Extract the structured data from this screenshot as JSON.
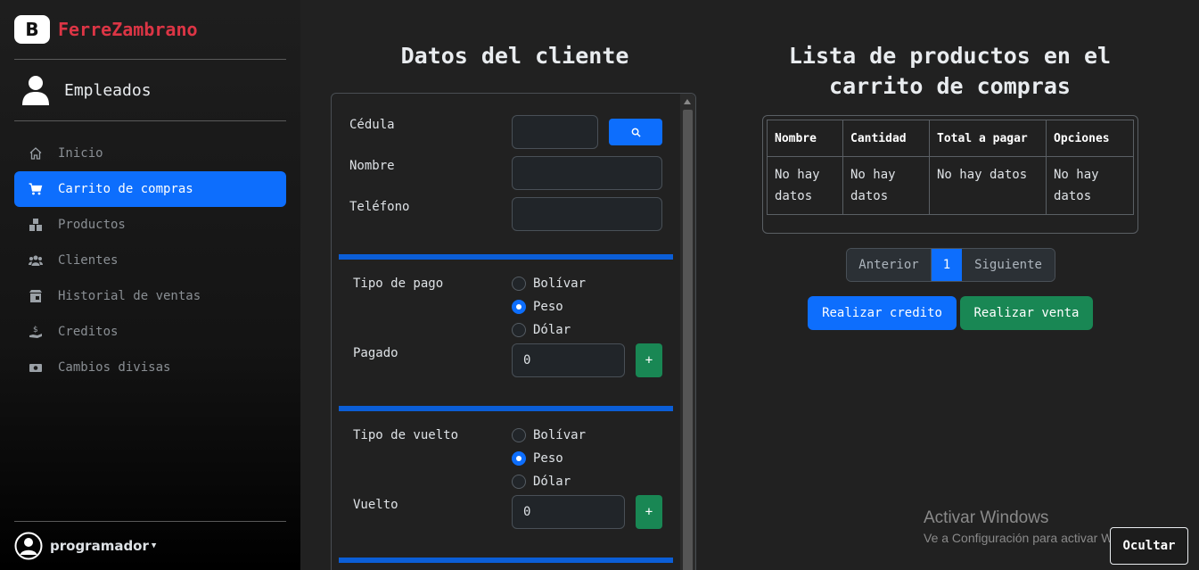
{
  "brand": {
    "logo_letter": "B",
    "name": "FerreZambrano",
    "color": "#dc3545"
  },
  "user_section": {
    "label": "Empleados"
  },
  "nav": {
    "items": [
      {
        "label": "Inicio",
        "icon": "home-icon",
        "active": false
      },
      {
        "label": "Carrito de compras",
        "icon": "cart-icon",
        "active": true
      },
      {
        "label": "Productos",
        "icon": "boxes-icon",
        "active": false
      },
      {
        "label": "Clientes",
        "icon": "people-icon",
        "active": false
      },
      {
        "label": "Historial de ventas",
        "icon": "shop-history-icon",
        "active": false
      },
      {
        "label": "Creditos",
        "icon": "hand-dollar-icon",
        "active": false
      },
      {
        "label": "Cambios divisas",
        "icon": "cash-exchange-icon",
        "active": false
      }
    ]
  },
  "footer": {
    "username": "programador"
  },
  "client": {
    "title": "Datos del cliente",
    "cedula_label": "Cédula",
    "cedula_value": "",
    "nombre_label": "Nombre",
    "nombre_value": "",
    "telefono_label": "Teléfono",
    "telefono_value": ""
  },
  "payment": {
    "type_label": "Tipo de pago",
    "options": [
      "Bolívar",
      "Peso",
      "Dólar"
    ],
    "selected": "Peso",
    "paid_label": "Pagado",
    "paid_value": "0",
    "add_label": "+"
  },
  "change": {
    "type_label": "Tipo de vuelto",
    "options": [
      "Bolívar",
      "Peso",
      "Dólar"
    ],
    "selected": "Peso",
    "change_label": "Vuelto",
    "change_value": "0",
    "add_label": "+"
  },
  "cart": {
    "title_line1": "Lista de productos en el",
    "title_line2": "carrito de compras",
    "columns": [
      "Nombre",
      "Cantidad",
      "Total a pagar",
      "Opciones"
    ],
    "row": [
      "No hay datos",
      "No hay datos",
      "No hay datos",
      "No hay datos"
    ]
  },
  "pagination": {
    "prev": "Anterior",
    "page": "1",
    "next": "Siguiente"
  },
  "actions": {
    "credit": "Realizar credito",
    "sale": "Realizar venta"
  },
  "watermark": {
    "line1": "Activar Windows",
    "line2": "Ve a Configuración para activar Windows."
  },
  "hide_button": "Ocultar",
  "colors": {
    "primary": "#0d6efd",
    "success": "#198754",
    "background": "#212121"
  }
}
